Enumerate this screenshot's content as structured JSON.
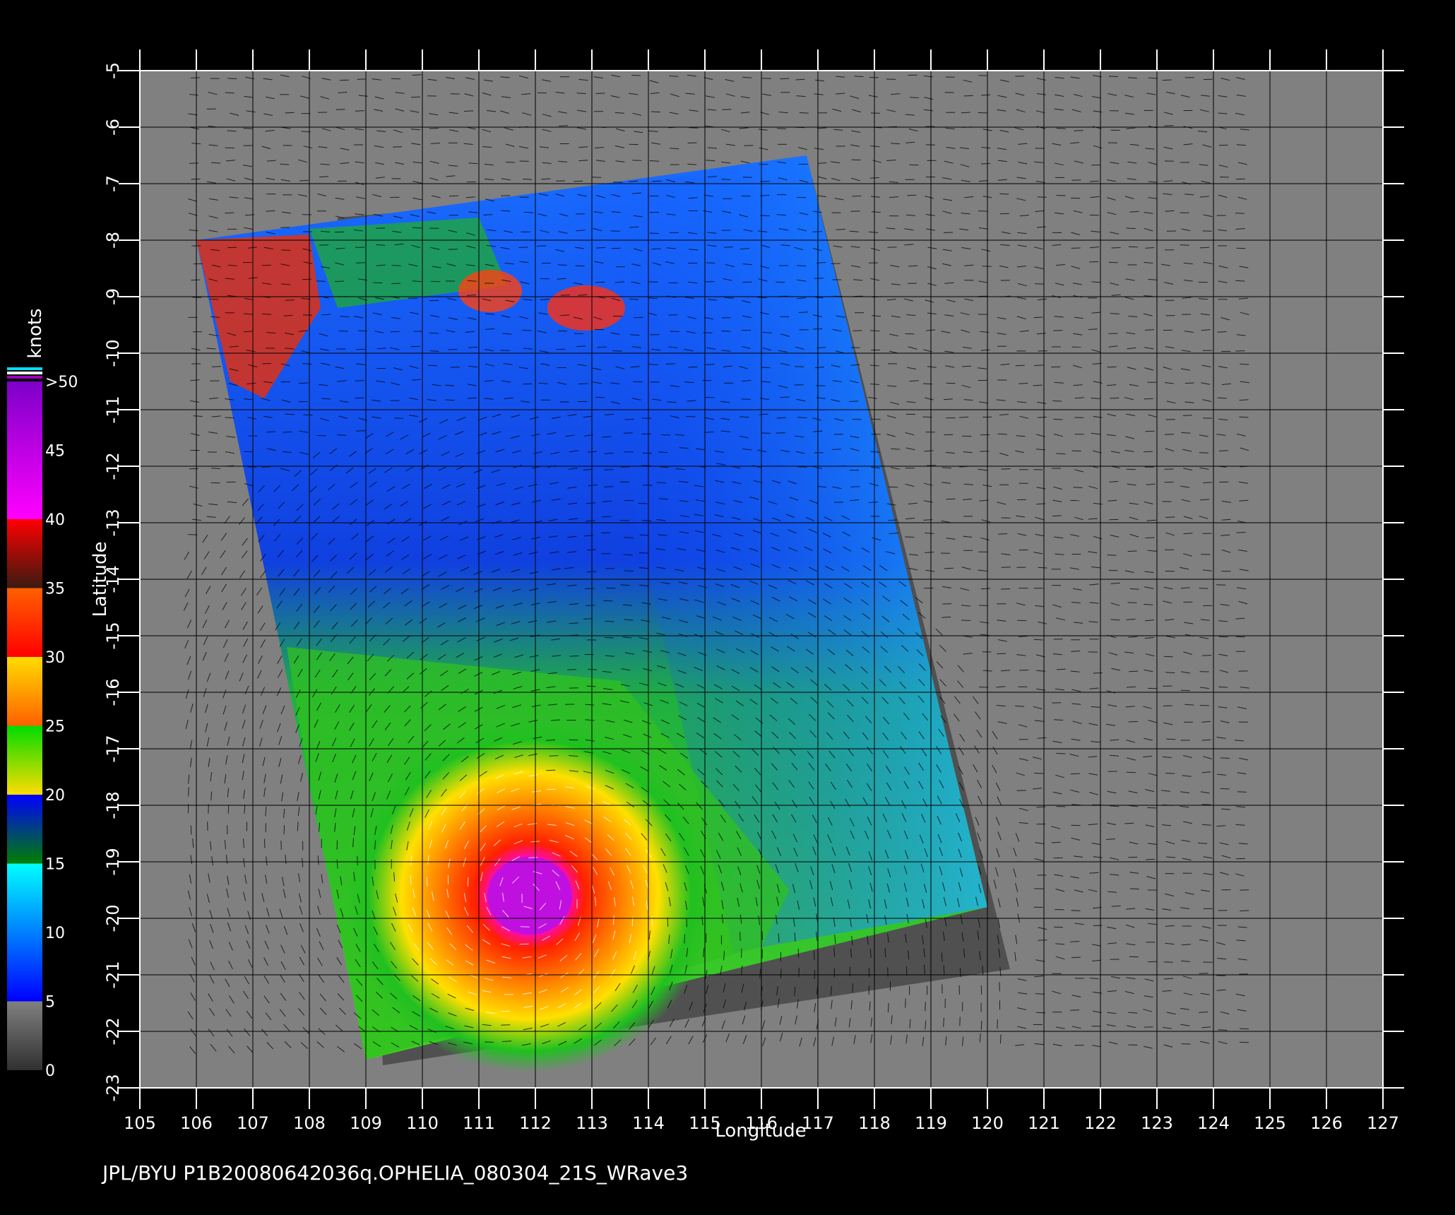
{
  "map": {
    "x_axis": {
      "label": "Longitude",
      "min": 105,
      "max": 127,
      "ticks": [
        "105",
        "106",
        "107",
        "108",
        "109",
        "110",
        "111",
        "112",
        "113",
        "114",
        "115",
        "116",
        "117",
        "118",
        "119",
        "120",
        "121",
        "122",
        "123",
        "124",
        "125",
        "126",
        "127"
      ]
    },
    "y_axis": {
      "label": "Latitude",
      "min": -23,
      "max": -5,
      "ticks": [
        "-5",
        "-6",
        "-7",
        "-8",
        "-9",
        "-10",
        "-11",
        "-12",
        "-13",
        "-14",
        "-15",
        "-16",
        "-17",
        "-18",
        "-19",
        "-20",
        "-21",
        "-22",
        "-23"
      ]
    },
    "swath_corners_lonlat": [
      [
        106.0,
        -8.0
      ],
      [
        116.8,
        -6.5
      ],
      [
        120.0,
        -19.8
      ],
      [
        109.0,
        -22.5
      ]
    ],
    "storm_center_lonlat": [
      111.9,
      -19.6
    ],
    "background_color": "#808080",
    "grid_color": "#000000"
  },
  "legend": {
    "title": "knots",
    "labels": [
      ">50",
      "45",
      "40",
      "35",
      "30",
      "25",
      "20",
      "15",
      "10",
      "5",
      "0"
    ],
    "bands": [
      {
        "range": [
          40,
          50
        ],
        "from": "#7d00c8",
        "to": "#ff00ff"
      },
      {
        "range": [
          35,
          40
        ],
        "from": "#ff0000",
        "to": "#3a1a10"
      },
      {
        "range": [
          30,
          35
        ],
        "from": "#ff6000",
        "to": "#ff0000"
      },
      {
        "range": [
          25,
          30
        ],
        "from": "#ffdc00",
        "to": "#ff6000"
      },
      {
        "range": [
          20,
          25
        ],
        "from": "#00dc00",
        "to": "#ffdc00"
      },
      {
        "range": [
          15,
          20
        ],
        "from": "#0000ff",
        "to": "#008000"
      },
      {
        "range": [
          5,
          15
        ],
        "from": "#00ffff",
        "to": "#0000ff"
      },
      {
        "range": [
          0,
          5
        ],
        "from": "#808080",
        "to": "#303030"
      }
    ]
  },
  "footer": {
    "caption": "JPL/BYU  P1B20080642036q.OPHELIA_080304_21S_WRave3"
  }
}
